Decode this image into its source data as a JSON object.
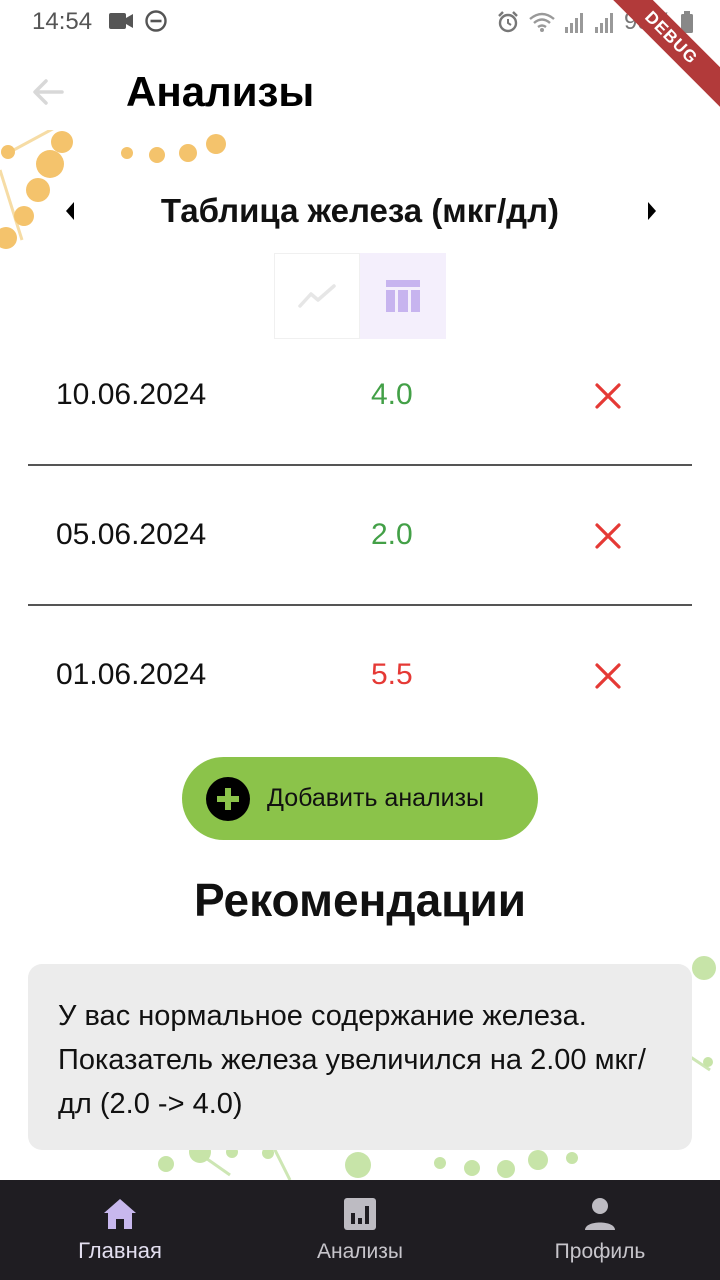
{
  "status_bar": {
    "time": "14:54",
    "battery": "99%",
    "debug_label": "DEBUG"
  },
  "app_bar": {
    "title": "Анализы"
  },
  "chart": {
    "title": "Таблица железа (мкг/дл)",
    "active_view": "table"
  },
  "records": [
    {
      "date": "10.06.2024",
      "value": "4.0",
      "status": "normal"
    },
    {
      "date": "05.06.2024",
      "value": "2.0",
      "status": "normal"
    },
    {
      "date": "01.06.2024",
      "value": "5.5",
      "status": "high"
    }
  ],
  "add_button": {
    "label": "Добавить анализы"
  },
  "recommendations": {
    "title": "Рекомендации",
    "text": "У вас нормальное содержание железа. Показатель железа увеличился на 2.00 мкг/дл (2.0 -> 4.0)"
  },
  "bottom_nav": {
    "items": [
      {
        "label": "Главная",
        "icon": "home-icon",
        "active": true
      },
      {
        "label": "Анализы",
        "icon": "chart-icon",
        "active": false
      },
      {
        "label": "Профиль",
        "icon": "profile-icon",
        "active": false
      }
    ]
  },
  "colors": {
    "normal_value": "#43a047",
    "high_value": "#e53935",
    "delete_icon": "#e53935",
    "add_button_bg": "#8bc34a",
    "nav_bg": "#1f1d22",
    "toggle_active_bg": "#f4effc",
    "toggle_active_icon": "#c7b4ef"
  }
}
